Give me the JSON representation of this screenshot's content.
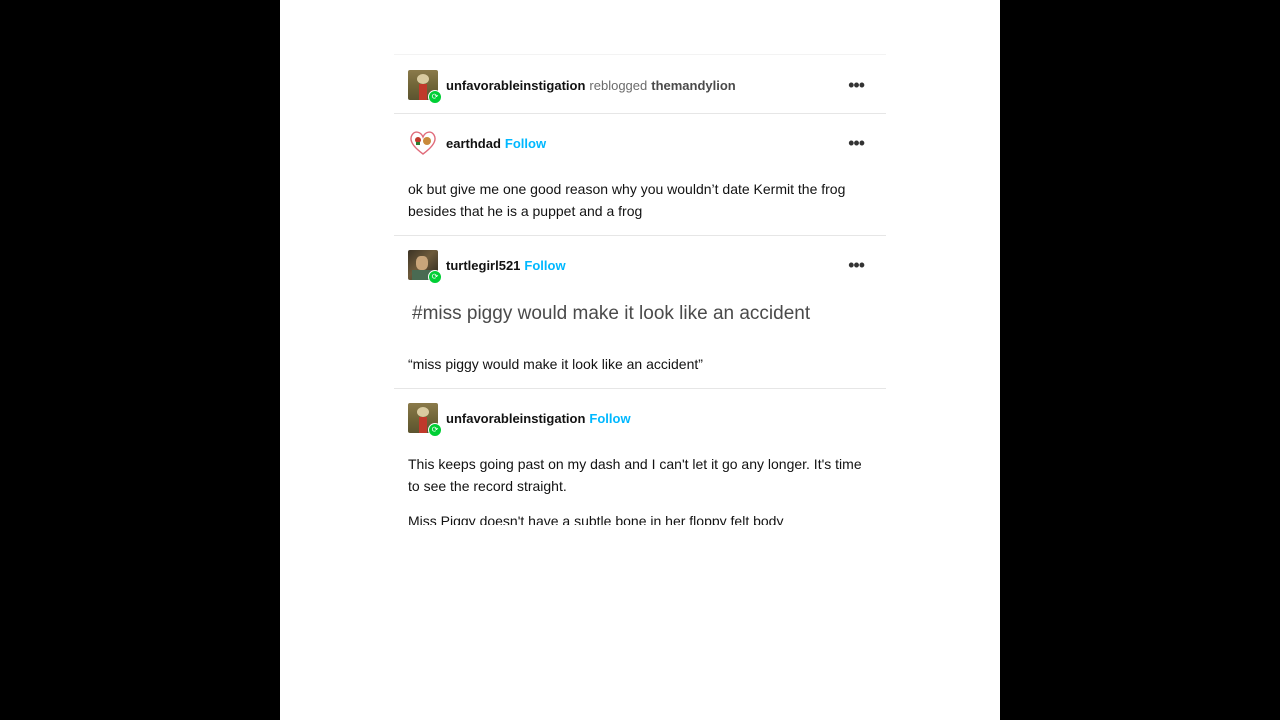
{
  "header": {
    "reblogger": "unfavorableinstigation",
    "reblogged_text": "reblogged",
    "source": "themandylion"
  },
  "posts": [
    {
      "username": "earthdad",
      "follow": "Follow",
      "text": "ok but give me one good reason why you wouldn’t date Kermit the frog besides that he is a puppet and a frog"
    },
    {
      "username": "turtlegirl521",
      "follow": "Follow",
      "tag_heading": "#miss piggy would make it look like an accident",
      "text": "“miss piggy would make it look like an accident”"
    },
    {
      "username": "unfavorableinstigation",
      "follow": "Follow",
      "text": "This keeps going past on my dash and I can't let it go any longer. It's time to see the record straight.",
      "text2": "Miss Piggy doesn't have a subtle bone in her floppy felt body"
    }
  ],
  "icons": {
    "more": "more-options-icon",
    "reblog": "reblog-icon"
  },
  "colors": {
    "follow": "#00b8ff",
    "reblog_badge": "#00cf35"
  }
}
